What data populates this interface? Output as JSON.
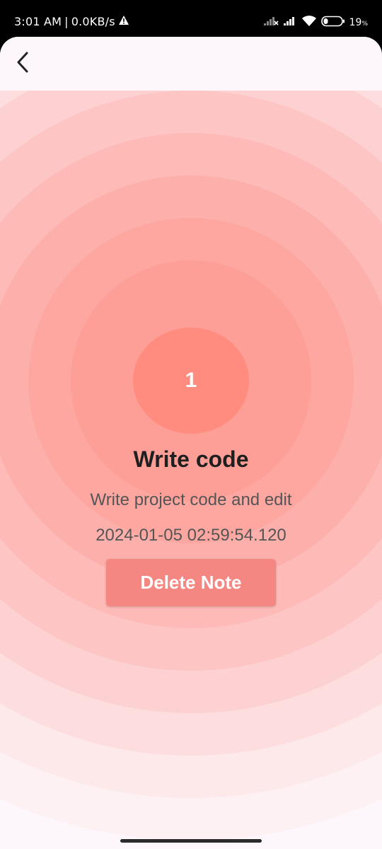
{
  "status_bar": {
    "time": "3:01 AM",
    "separator": "|",
    "net_speed": "0.0KB/s",
    "alert_icon": "warning-triangle-icon",
    "battery_percent": "19",
    "battery_unit": "%"
  },
  "app_bar": {
    "back_icon": "chevron-left-icon"
  },
  "note": {
    "number": "1",
    "title": "Write code",
    "description": "Write project code and edit",
    "timestamp": "2024-01-05 02:59:54.120"
  },
  "actions": {
    "delete_label": "Delete Note"
  },
  "colors": {
    "accent_circle": "#ff8c7e",
    "delete_button": "#f58782",
    "ripple": "#ff8a80",
    "surface": "#fdf7fb"
  }
}
